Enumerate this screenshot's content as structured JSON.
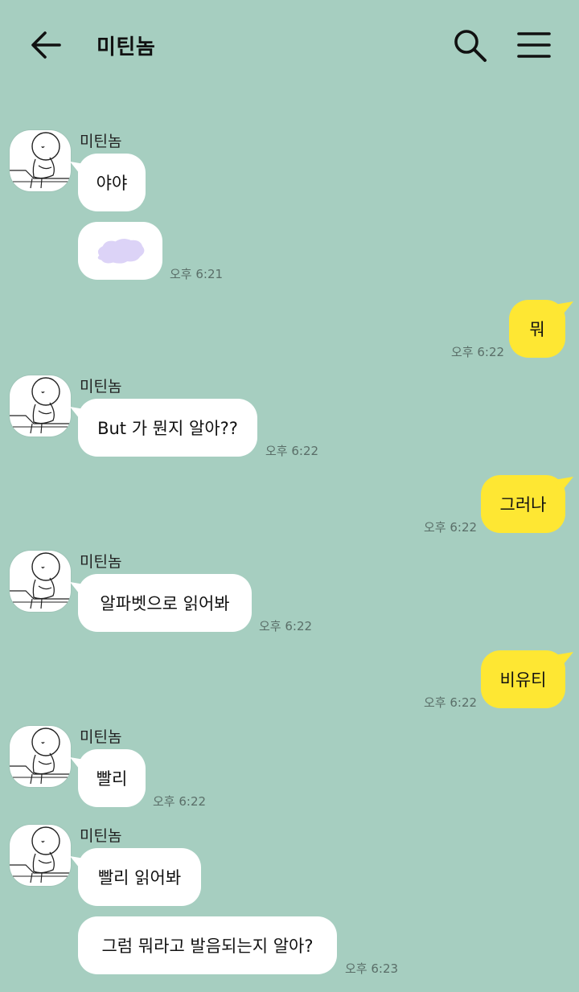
{
  "header": {
    "title": "미틴놈"
  },
  "colors": {
    "background": "#a6cec0",
    "incoming_bubble": "#ffffff",
    "outgoing_bubble": "#fee733",
    "censor_blob": "#dcd3f7"
  },
  "icons": [
    "back-arrow-icon",
    "search-icon",
    "hamburger-menu-icon",
    "avatar-figure-icon"
  ],
  "messages": [
    {
      "sender": "미틴놈",
      "text": "야야"
    },
    {
      "text": "",
      "time": "오후 6:21",
      "redacted": true
    },
    {
      "text": "뭐",
      "time": "오후 6:22"
    },
    {
      "sender": "미틴놈",
      "text": "But 가 뭔지 알아??",
      "time": "오후 6:22"
    },
    {
      "text": "그러나",
      "time": "오후 6:22"
    },
    {
      "sender": "미틴놈",
      "text": "알파벳으로 읽어봐",
      "time": "오후 6:22"
    },
    {
      "text": "비유티",
      "time": "오후 6:22"
    },
    {
      "sender": "미틴놈",
      "text": "빨리",
      "time": "오후 6:22"
    },
    {
      "sender": "미틴놈",
      "text": "빨리 읽어봐"
    },
    {
      "text": "그럼 뭐라고 발음되는지 알아?",
      "time": "오후 6:23"
    }
  ]
}
